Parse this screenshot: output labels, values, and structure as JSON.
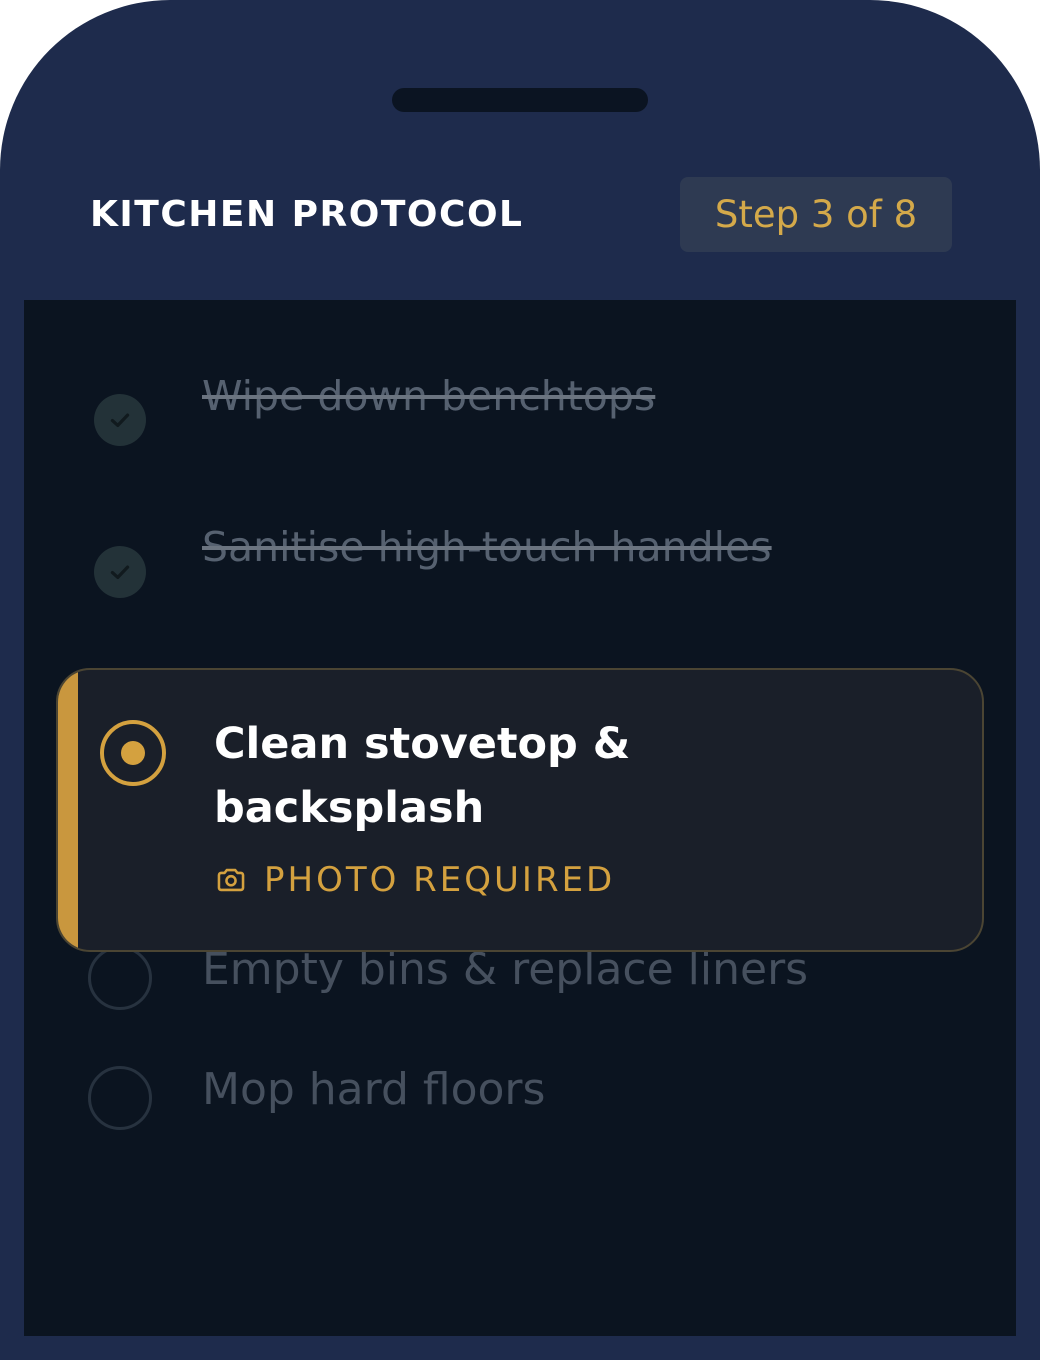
{
  "header": {
    "title": "KITCHEN PROTOCOL",
    "step_badge": "Step 3 of 8"
  },
  "progress": {
    "current_step": 3,
    "total_steps": 8
  },
  "tasks": {
    "completed": [
      {
        "label": "Wipe down benchtops",
        "status": "done"
      },
      {
        "label": "Sanitise high-touch handles",
        "status": "done"
      }
    ],
    "active": {
      "label": "Clean stovetop & backsplash",
      "requirement_label": "PHOTO REQUIRED",
      "requirement_icon": "camera-icon",
      "status": "in-progress"
    },
    "upcoming": [
      {
        "label": "Empty bins & replace liners",
        "status": "pending"
      },
      {
        "label": "Mop hard floors",
        "status": "pending"
      }
    ]
  },
  "colors": {
    "frame": "#1e2b4c",
    "screen": "#0b1420",
    "accent_gold": "#d4a13f",
    "card": "#1a1f29",
    "badge_bg": "#2e3a52"
  }
}
